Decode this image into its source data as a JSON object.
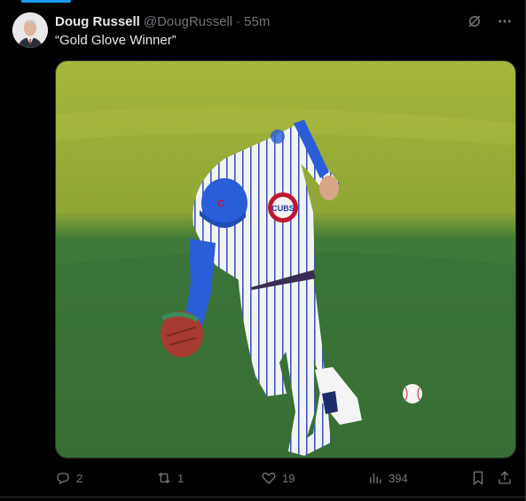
{
  "tweet": {
    "author_name": "Doug Russell",
    "handle": "@DougRussell",
    "separator": "·",
    "time": "55m",
    "text": "“Gold Glove Winner”"
  },
  "media": {
    "jersey_logo_text": "CUBS",
    "cap_letter": "C"
  },
  "actions": {
    "replies": "2",
    "reposts": "1",
    "likes": "19",
    "views": "394"
  },
  "icons": [
    "grok-icon",
    "more-icon",
    "reply-icon",
    "repost-icon",
    "like-icon",
    "views-icon",
    "bookmark-icon",
    "share-icon"
  ],
  "colors": {
    "background": "#000000",
    "text_primary": "#e7e9ea",
    "text_secondary": "#71767b",
    "accent": "#1d9bf0"
  }
}
